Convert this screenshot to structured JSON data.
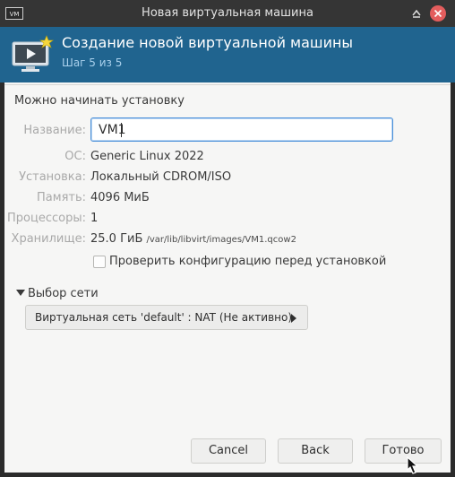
{
  "window": {
    "title": "Новая виртуальная машина"
  },
  "header": {
    "title": "Создание новой виртуальной машины",
    "step": "Шаг 5 из 5"
  },
  "content": {
    "ready_text": "Можно начинать установку",
    "fields": {
      "name_label": "Название:",
      "name_value": "VM1",
      "os_label": "ОС:",
      "os_value": "Generic Linux 2022",
      "install_label": "Установка:",
      "install_value": "Локальный CDROM/ISO",
      "memory_label": "Память:",
      "memory_value": "4096 МиБ",
      "cpu_label": "Процессоры:",
      "cpu_value": "1",
      "storage_label": "Хранилище:",
      "storage_size": "25.0 ГиБ",
      "storage_path": "/var/lib/libvirt/images/VM1.qcow2"
    },
    "checkbox_label": "Проверить конфигурацию перед установкой",
    "checkbox_checked": false,
    "network_section_label": "Выбор сети",
    "network_value": "Виртуальная сеть 'default' : NAT (Не активно)"
  },
  "buttons": {
    "cancel": "Cancel",
    "back": "Back",
    "finish": "Готово"
  },
  "icons": {
    "app": "vm-manager-icon",
    "header": "monitor-play-icon",
    "restore": "restore-icon",
    "close": "close-icon"
  },
  "colors": {
    "header_bg": "#20648f",
    "titlebar_bg": "#353535",
    "close_button": "#e35d5d",
    "focus_border": "#4a90d9"
  }
}
